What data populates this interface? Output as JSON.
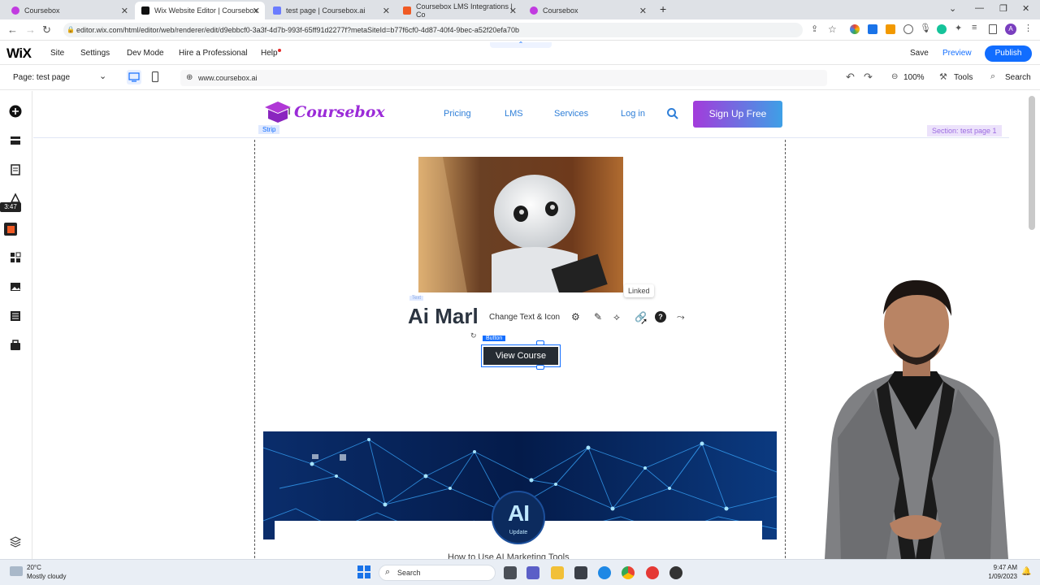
{
  "browser": {
    "tabs": [
      {
        "title": "Coursebox",
        "favicon_color": "#c13be0",
        "active": false
      },
      {
        "title": "Wix Website Editor | Coursebox",
        "favicon_color": "#111111",
        "active": true
      },
      {
        "title": "test page | Coursebox.ai",
        "favicon_color": "#6b7cff",
        "active": false
      },
      {
        "title": "Coursebox LMS Integrations | Co",
        "favicon_color": "#f05a24",
        "active": false
      },
      {
        "title": "Coursebox",
        "favicon_color": "#c13be0",
        "active": false
      }
    ],
    "new_tab": "+",
    "url": "editor.wix.com/html/editor/web/renderer/edit/d9ebbcf0-3a3f-4d7b-993f-65ff91d2277f?metaSiteId=b77f6cf0-4d87-40f4-9bec-a52f20efa70b"
  },
  "wix": {
    "logo": "WiX",
    "menu": [
      "Site",
      "Settings",
      "Dev Mode",
      "Hire a Professional",
      "Help"
    ],
    "save": "Save",
    "preview": "Preview",
    "publish": "Publish",
    "page_label": "Page: test page",
    "site_url": "www.coursebox.ai",
    "zoom": "100%",
    "tools": "Tools",
    "search": "Search",
    "rail_timer": "3:47"
  },
  "site": {
    "logo": "Coursebox",
    "nav": [
      "Pricing",
      "LMS",
      "Services",
      "Log in"
    ],
    "cta": "Sign Up Free",
    "strip_tag": "Strip",
    "section_tag": "Section: test page 1",
    "heading": "Ai Marl",
    "text_tag": "Text",
    "toolbar_label": "Change Text & Icon",
    "linked_tooltip": "Linked",
    "button_tag": "Button",
    "button_text": "View Course",
    "banner_badge": "AI",
    "banner_badge_sub": "Update",
    "article_caption": "How to Use AI Marketing Tools"
  },
  "taskbar": {
    "temp": "20°C",
    "weather": "Mostly cloudy",
    "search": "Search",
    "time": "9:47 AM",
    "date": "1/09/2023"
  },
  "colors": {
    "wix_blue": "#116dff",
    "brand_purple": "#9b2bd8",
    "nav_blue": "#2f7fd8"
  }
}
